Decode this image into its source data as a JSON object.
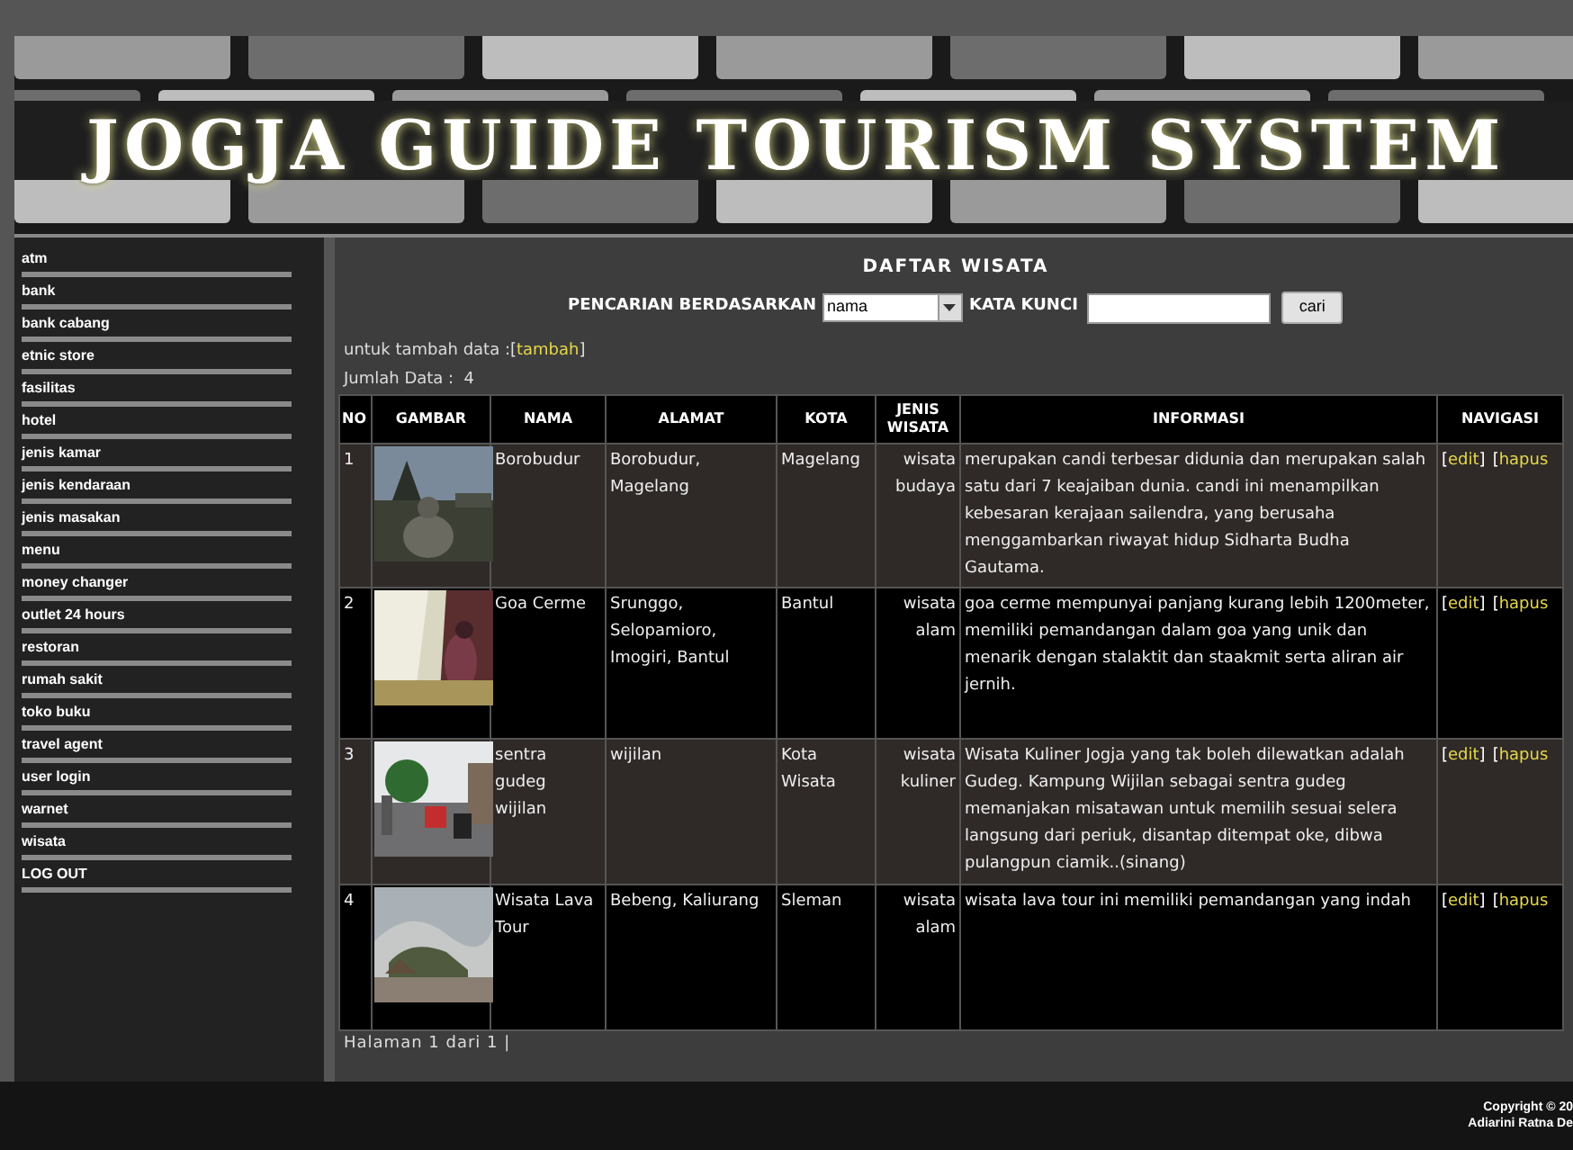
{
  "banner": {
    "title": "JOGJA GUIDE TOURISM SYSTEM"
  },
  "sidebar": {
    "items": [
      {
        "label": "atm"
      },
      {
        "label": "bank"
      },
      {
        "label": "bank cabang"
      },
      {
        "label": "etnic store"
      },
      {
        "label": "fasilitas"
      },
      {
        "label": "hotel"
      },
      {
        "label": "jenis kamar"
      },
      {
        "label": "jenis kendaraan"
      },
      {
        "label": "jenis masakan"
      },
      {
        "label": "menu"
      },
      {
        "label": "money changer"
      },
      {
        "label": "outlet 24 hours"
      },
      {
        "label": "restoran"
      },
      {
        "label": "rumah sakit"
      },
      {
        "label": "toko buku"
      },
      {
        "label": "travel agent"
      },
      {
        "label": "user login"
      },
      {
        "label": "warnet"
      },
      {
        "label": "wisata"
      },
      {
        "label": "LOG OUT"
      }
    ]
  },
  "main": {
    "title": "DAFTAR WISATA",
    "search": {
      "by_label": "PENCARIAN BERDASARKAN",
      "by_value": "nama",
      "keyword_label": "KATA KUNCI",
      "button": "cari"
    },
    "add": {
      "text": "untuk tambah data :[",
      "link": "tambah",
      "after": "]"
    },
    "count": "Jumlah Data :  4",
    "table": {
      "columns": [
        "NO",
        "GAMBAR",
        "NAMA",
        "ALAMAT",
        "KOTA",
        "JENIS WISATA",
        "INFORMASI",
        "NAVIGASI"
      ],
      "rows": [
        {
          "no": "1",
          "nama": "Borobudur",
          "alamat": "Borobudur, Magelang",
          "kota": "Magelang",
          "jenis": "wisata budaya",
          "informasi": "merupakan candi terbesar didunia dan merupakan salah satu dari 7 keajaiban dunia. candi ini menampilkan kebesaran kerajaan sailendra, yang berusaha menggambarkan riwayat hidup Sidharta Budha Gautama.",
          "actions": [
            {
              "open": "[",
              "label": "edit",
              "close": "]"
            },
            {
              "open": "[",
              "label": "hapus"
            }
          ]
        },
        {
          "no": "2",
          "nama": "Goa Cerme",
          "alamat": "Srunggo, Selopamioro, Imogiri, Bantul",
          "kota": "Bantul",
          "jenis": "wisata alam",
          "informasi": "goa cerme mempunyai panjang kurang lebih 1200meter, memiliki pemandangan dalam goa yang unik dan menarik dengan stalaktit dan staakmit serta aliran air jernih.",
          "actions": [
            {
              "open": "[",
              "label": "edit",
              "close": "]"
            },
            {
              "open": "[",
              "label": "hapus"
            }
          ]
        },
        {
          "no": "3",
          "nama": "sentra gudeg wijilan",
          "alamat": "wijilan",
          "kota": "Kota Wisata",
          "jenis": "wisata kuliner",
          "informasi": "Wisata Kuliner Jogja yang tak boleh dilewatkan adalah Gudeg. Kampung Wijilan sebagai sentra gudeg memanjakan misatawan untuk memilih sesuai selera langsung dari periuk, disantap ditempat oke, dibwa pulangpun ciamik..(sinang)",
          "actions": [
            {
              "open": "[",
              "label": "edit",
              "close": "]"
            },
            {
              "open": "[",
              "label": "hapus"
            }
          ]
        },
        {
          "no": "4",
          "nama": "Wisata Lava Tour",
          "alamat": "Bebeng, Kaliurang",
          "kota": "Sleman",
          "jenis": "wisata alam",
          "informasi": "wisata lava tour ini memiliki pemandangan yang indah",
          "actions": [
            {
              "open": "[",
              "label": "edit",
              "close": "]"
            },
            {
              "open": "[",
              "label": "hapus"
            }
          ]
        }
      ]
    },
    "pagination": "Halaman 1 dari 1 |"
  },
  "footer": {
    "lines": [
      "Copyright © 20",
      "Adiarini Ratna De"
    ]
  }
}
